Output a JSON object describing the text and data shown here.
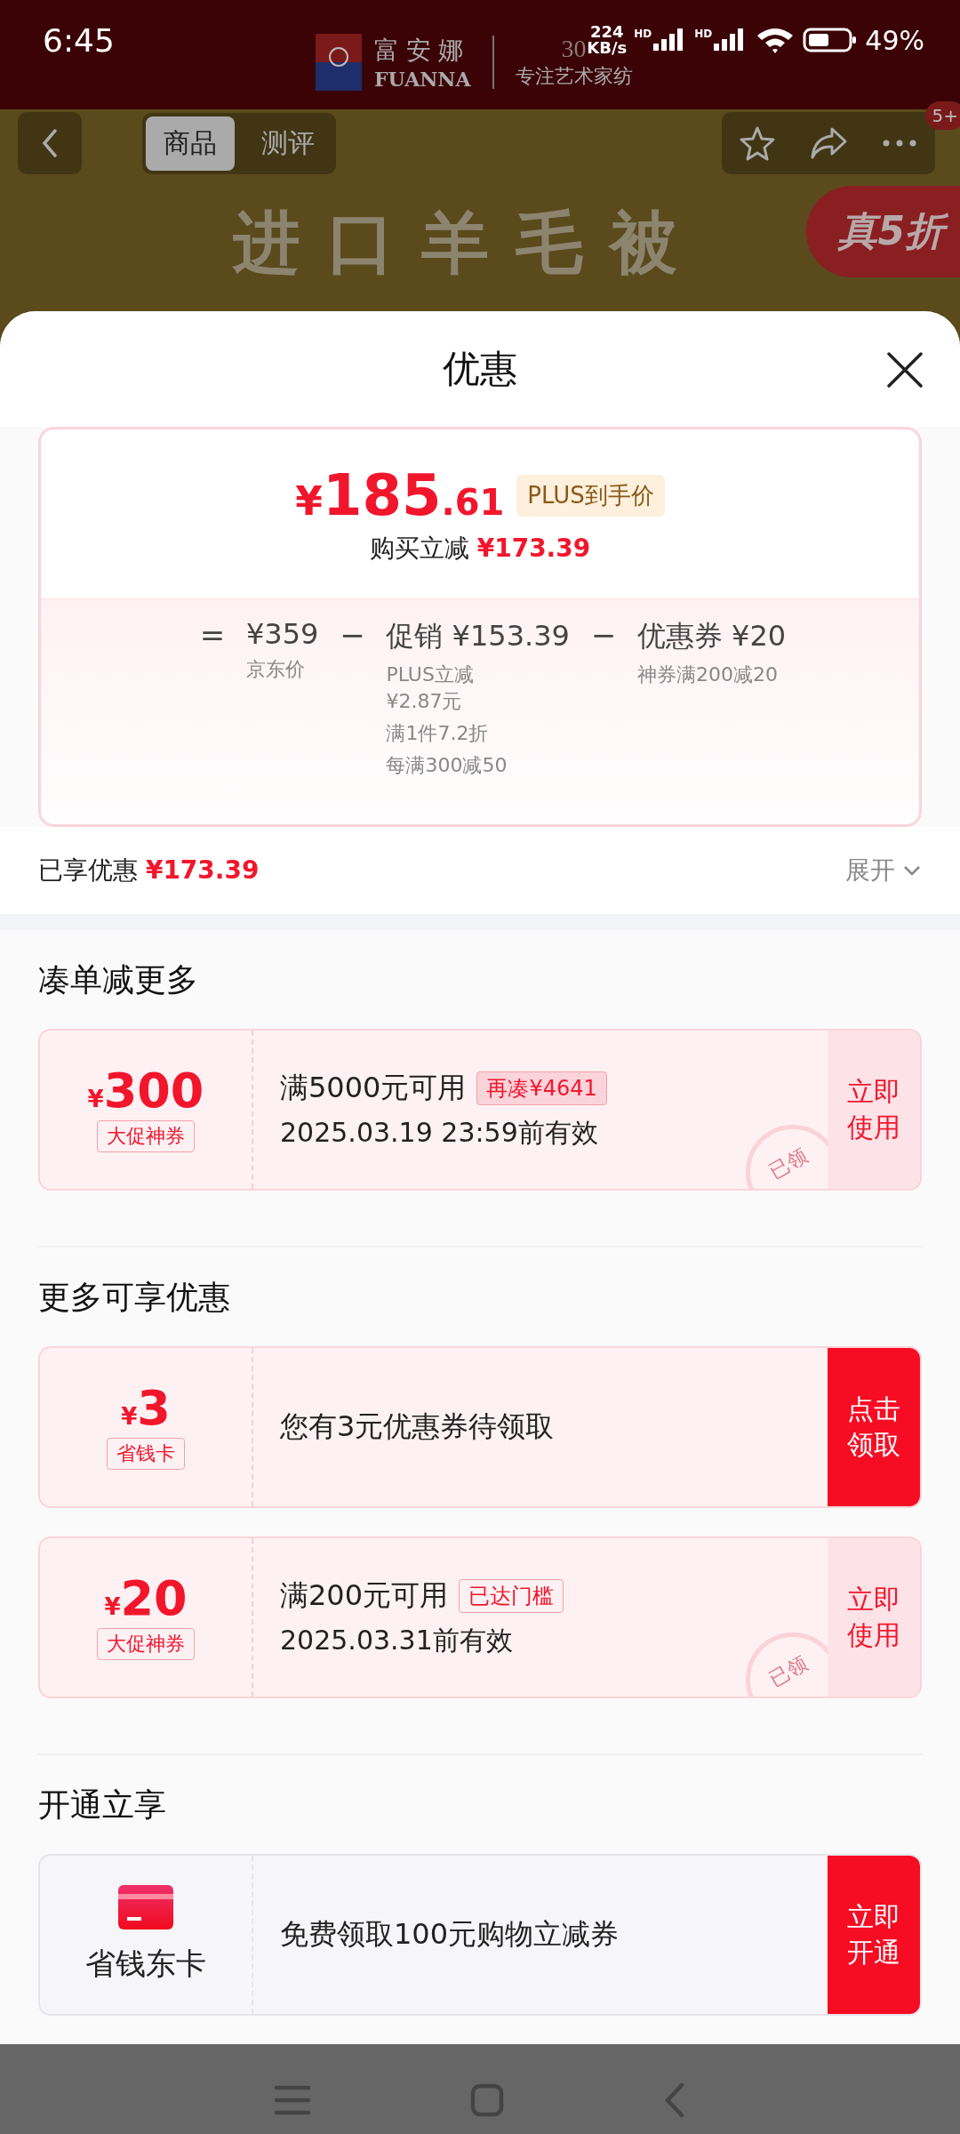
{
  "status_bar": {
    "time": "6:45",
    "speed_value": "224",
    "speed_unit": "KB/s",
    "network_labels": [
      "HD",
      "HD"
    ],
    "battery": "49%"
  },
  "brand_header": {
    "name_cn": "富安娜",
    "name_en": "FUANNA",
    "years": "30",
    "slogan": "专注艺术家纺"
  },
  "nav": {
    "tabs": [
      {
        "label": "商品",
        "selected": true
      },
      {
        "label": "测评",
        "selected": false
      }
    ],
    "badge": "5+"
  },
  "banner": {
    "headline": "进口羊毛被",
    "sticker": "真5折"
  },
  "sheet": {
    "title": "优惠"
  },
  "price_card": {
    "currency": "¥",
    "price_int": "185",
    "price_dec": ".61",
    "price_tag": "PLUS到手价",
    "instant_label": "购买立减",
    "instant_amount": "¥173.39",
    "breakdown": [
      {
        "op": "=",
        "value": "¥359",
        "notes": [
          "京东价"
        ]
      },
      {
        "op": "−",
        "value": "促销 ¥153.39",
        "notes": [
          "PLUS立减¥2.87元",
          "满1件7.2折",
          "每满300减50"
        ]
      },
      {
        "op": "−",
        "value": "优惠券 ¥20",
        "notes": [
          "神券满200减20"
        ]
      }
    ]
  },
  "summary": {
    "label": "已享优惠",
    "amount": "¥173.39",
    "expand": "展开"
  },
  "sections": [
    {
      "title": "凑单减更多",
      "items": [
        {
          "kind": "coupon",
          "currency": "¥",
          "amount": "300",
          "tag": "大促神券",
          "condition": "满5000元可用",
          "chip": "再凑¥4641",
          "chip_filled": true,
          "validity": "2025.03.19 23:59前有效",
          "stamp": "已领",
          "action": "立即使用",
          "action_primary": false
        }
      ]
    },
    {
      "title": "更多可享优惠",
      "items": [
        {
          "kind": "coupon",
          "currency": "¥",
          "amount": "3",
          "tag": "省钱卡",
          "condition": "您有3元优惠券待领取",
          "action": "点击领取",
          "action_primary": true
        },
        {
          "kind": "coupon",
          "currency": "¥",
          "amount": "20",
          "tag": "大促神券",
          "condition": "满200元可用",
          "chip": "已达门槛",
          "chip_filled": false,
          "validity": "2025.03.31前有效",
          "stamp": "已领",
          "action": "立即使用",
          "action_primary": false
        }
      ]
    },
    {
      "title": "开通立享",
      "items": [
        {
          "kind": "membership",
          "label": "省钱东卡",
          "condition": "免费领取100元购物立减券",
          "action": "立即开通",
          "action_primary": true
        }
      ]
    }
  ]
}
